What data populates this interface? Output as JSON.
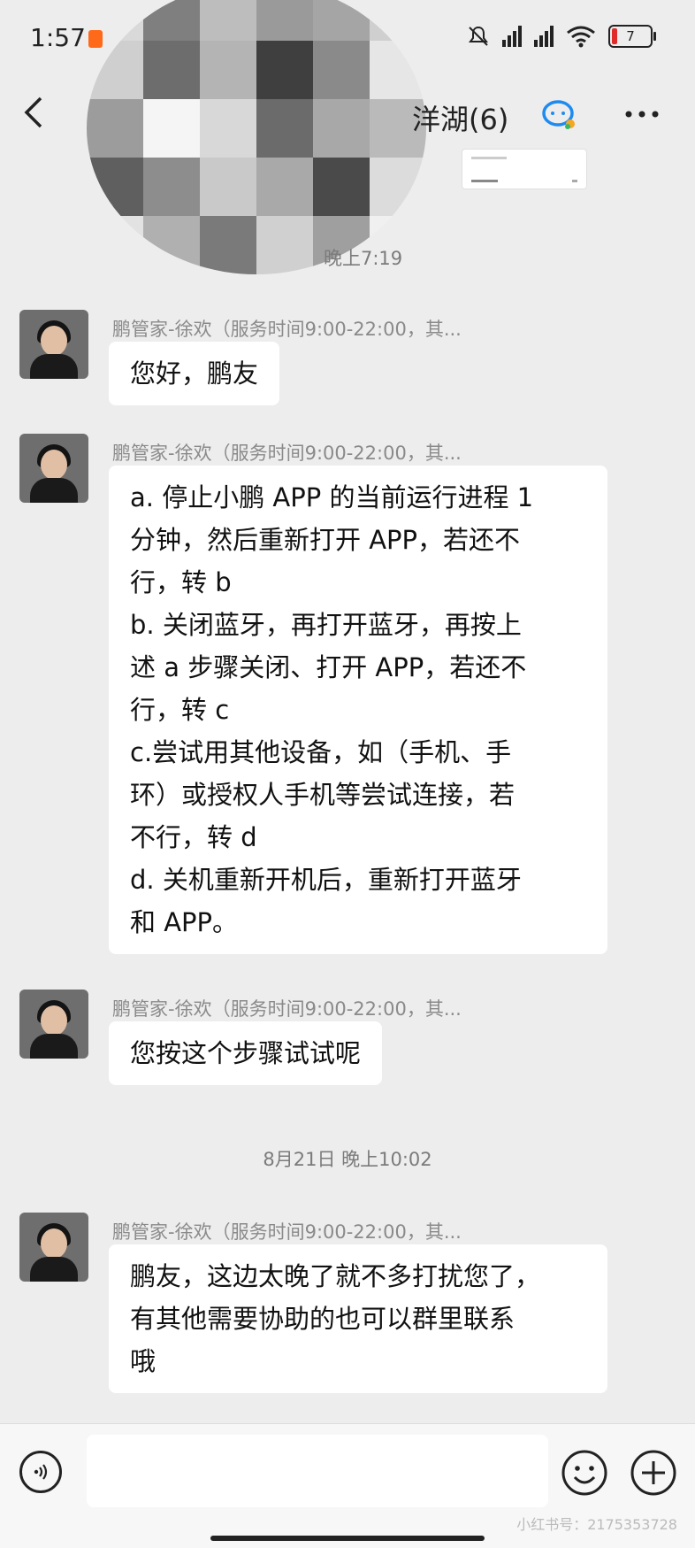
{
  "status_bar": {
    "time": "1:57",
    "battery": "7",
    "icons": [
      "mute-icon",
      "signal-icon",
      "signal-icon",
      "wifi-icon",
      "battery-icon"
    ]
  },
  "nav": {
    "title": "洋湖(6)",
    "back_icon": "back-icon",
    "more_icon": "more-icon"
  },
  "timestamps": {
    "first": "晚上7:19",
    "second": "8月21日 晚上10:02"
  },
  "messages": [
    {
      "sender": "鹏管家-徐欢（服务时间9:00-22:00，其...",
      "lines": [
        "您好，鹏友"
      ]
    },
    {
      "sender": "鹏管家-徐欢（服务时间9:00-22:00，其...",
      "lines": [
        "a. 停止小鹏 APP 的当前运行进程 1",
        "分钟，然后重新打开 APP，若还不",
        "行，转 b",
        "b. 关闭蓝牙，再打开蓝牙，再按上",
        "述 a 步骤关闭、打开 APP，若还不",
        "行，转 c",
        "c.尝试用其他设备，如（手机、手",
        "环）或授权人手机等尝试连接，若",
        "不行，转 d",
        "d. 关机重新开机后，重新打开蓝牙",
        "和 APP。"
      ]
    },
    {
      "sender": "鹏管家-徐欢（服务时间9:00-22:00，其...",
      "lines": [
        "您按这个步骤试试呢"
      ]
    },
    {
      "sender": "鹏管家-徐欢（服务时间9:00-22:00，其...",
      "lines": [
        "鹏友，这边太晚了就不多打扰您了，",
        "有其他需要协助的也可以群里联系",
        "哦"
      ]
    }
  ],
  "input_bar": {
    "placeholder": "",
    "voice_icon": "voice-icon",
    "emoji_icon": "emoji-icon",
    "plus_icon": "plus-icon"
  },
  "watermark": "小红书号：2175353728",
  "colors": {
    "background": "#ededed",
    "bubble": "#ffffff",
    "accent_blue": "#1e8bf0"
  }
}
